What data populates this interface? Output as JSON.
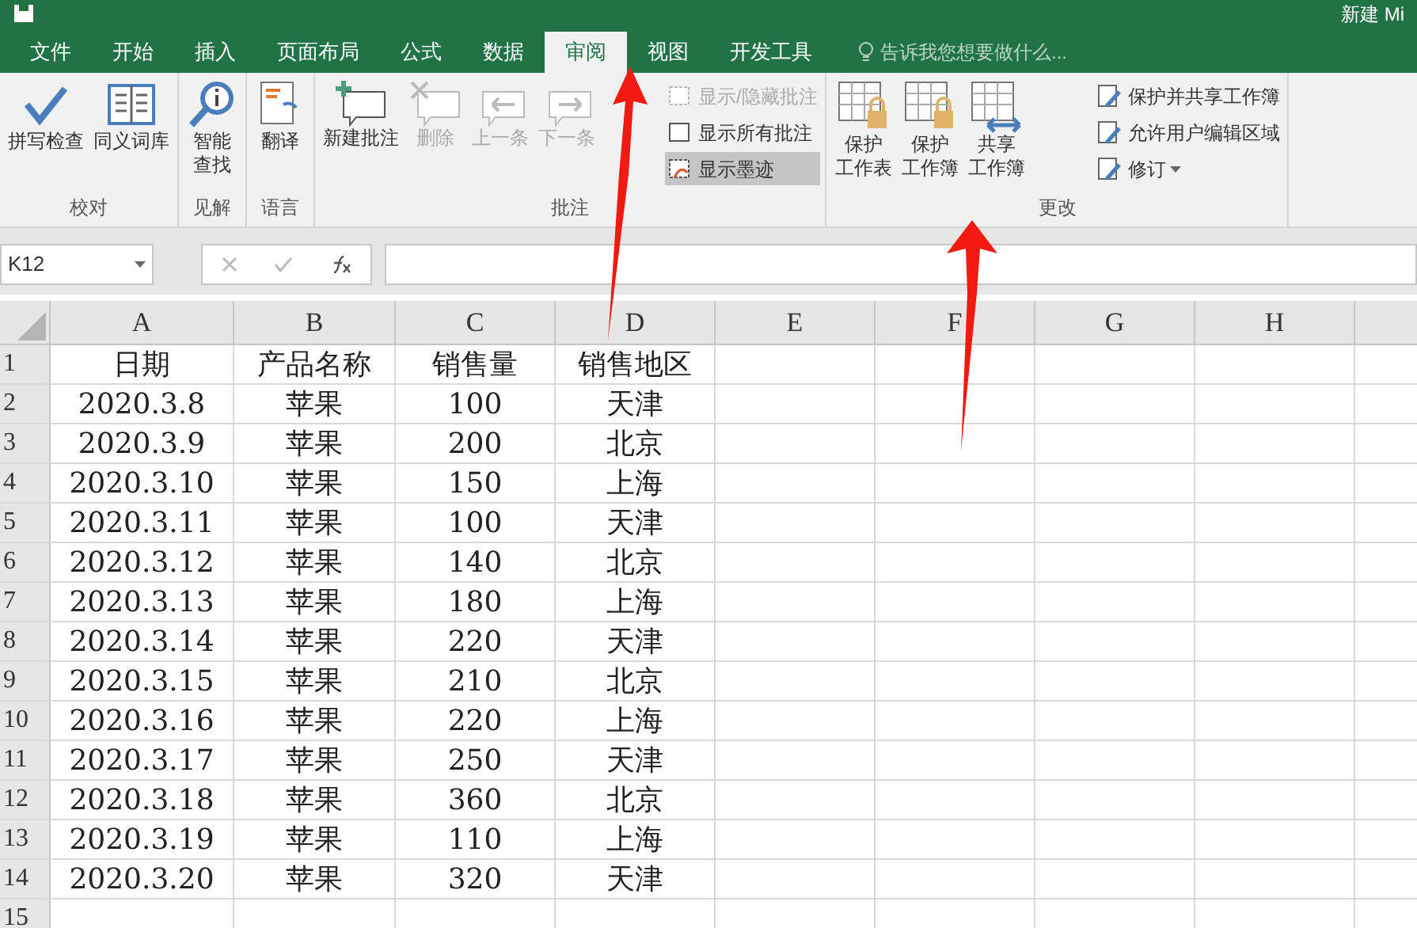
{
  "title": "新建 Mi",
  "tabs": [
    {
      "label": "文件",
      "selected": false
    },
    {
      "label": "开始",
      "selected": false
    },
    {
      "label": "插入",
      "selected": false
    },
    {
      "label": "页面布局",
      "selected": false
    },
    {
      "label": "公式",
      "selected": false
    },
    {
      "label": "数据",
      "selected": false
    },
    {
      "label": "审阅",
      "selected": true
    },
    {
      "label": "视图",
      "selected": false
    },
    {
      "label": "开发工具",
      "selected": false
    }
  ],
  "tell_me": "告诉我您想要做什么...",
  "ribbon_groups": [
    {
      "label": "校对",
      "buttons": [
        {
          "kind": "large",
          "lines": [
            "拼写检查"
          ],
          "disabled": false
        },
        {
          "kind": "large",
          "lines": [
            "同义词库"
          ],
          "disabled": false
        }
      ]
    },
    {
      "label": "见解",
      "buttons": [
        {
          "kind": "large",
          "lines": [
            "智能",
            "查找"
          ],
          "disabled": false
        }
      ]
    },
    {
      "label": "语言",
      "buttons": [
        {
          "kind": "large",
          "lines": [
            "翻译"
          ],
          "disabled": false
        }
      ]
    },
    {
      "label": "批注",
      "buttons": [
        {
          "kind": "large",
          "lines": [
            "新建批注"
          ],
          "disabled": false
        },
        {
          "kind": "large",
          "lines": [
            "删除"
          ],
          "disabled": true
        },
        {
          "kind": "large",
          "lines": [
            "上一条"
          ],
          "disabled": true
        },
        {
          "kind": "large",
          "lines": [
            "下一条"
          ],
          "disabled": true
        },
        {
          "kind": "small",
          "lines": [
            "显示/隐藏批注"
          ],
          "disabled": true,
          "selected": false
        },
        {
          "kind": "small",
          "lines": [
            "显示所有批注"
          ],
          "disabled": false,
          "selected": false
        },
        {
          "kind": "small",
          "lines": [
            "显示墨迹"
          ],
          "disabled": false,
          "selected": true
        }
      ]
    },
    {
      "label": "更改",
      "buttons": [
        {
          "kind": "large",
          "lines": [
            "保护",
            "工作表"
          ],
          "disabled": false
        },
        {
          "kind": "large",
          "lines": [
            "保护",
            "工作簿"
          ],
          "disabled": false
        },
        {
          "kind": "large",
          "lines": [
            "共享",
            "工作簿"
          ],
          "disabled": false
        },
        {
          "kind": "small",
          "lines": [
            "保护并共享工作簿"
          ],
          "disabled": false,
          "selected": false
        },
        {
          "kind": "small",
          "lines": [
            "允许用户编辑区域"
          ],
          "disabled": false,
          "selected": false
        },
        {
          "kind": "small",
          "lines": [
            "修订"
          ],
          "disabled": false,
          "selected": false,
          "dropdown": true
        }
      ]
    }
  ],
  "name_box": "K12",
  "columns": [
    "A",
    "B",
    "C",
    "D",
    "E",
    "F",
    "G",
    "H"
  ],
  "rows": [
    {
      "number": "1",
      "cells": [
        "日期",
        "产品名称",
        "销售量",
        "销售地区"
      ]
    },
    {
      "number": "2",
      "cells": [
        "2020.3.8",
        "苹果",
        "100",
        "天津"
      ]
    },
    {
      "number": "3",
      "cells": [
        "2020.3.9",
        "苹果",
        "200",
        "北京"
      ]
    },
    {
      "number": "4",
      "cells": [
        "2020.3.10",
        "苹果",
        "150",
        "上海"
      ]
    },
    {
      "number": "5",
      "cells": [
        "2020.3.11",
        "苹果",
        "100",
        "天津"
      ]
    },
    {
      "number": "6",
      "cells": [
        "2020.3.12",
        "苹果",
        "140",
        "北京"
      ]
    },
    {
      "number": "7",
      "cells": [
        "2020.3.13",
        "苹果",
        "180",
        "上海"
      ]
    },
    {
      "number": "8",
      "cells": [
        "2020.3.14",
        "苹果",
        "220",
        "天津"
      ]
    },
    {
      "number": "9",
      "cells": [
        "2020.3.15",
        "苹果",
        "210",
        "北京"
      ]
    },
    {
      "number": "10",
      "cells": [
        "2020.3.16",
        "苹果",
        "220",
        "上海"
      ]
    },
    {
      "number": "11",
      "cells": [
        "2020.3.17",
        "苹果",
        "250",
        "天津"
      ]
    },
    {
      "number": "12",
      "cells": [
        "2020.3.18",
        "苹果",
        "360",
        "北京"
      ]
    },
    {
      "number": "13",
      "cells": [
        "2020.3.19",
        "苹果",
        "110",
        "上海"
      ]
    },
    {
      "number": "14",
      "cells": [
        "2020.3.20",
        "苹果",
        "320",
        "天津"
      ]
    },
    {
      "number": "15",
      "cells": []
    }
  ]
}
